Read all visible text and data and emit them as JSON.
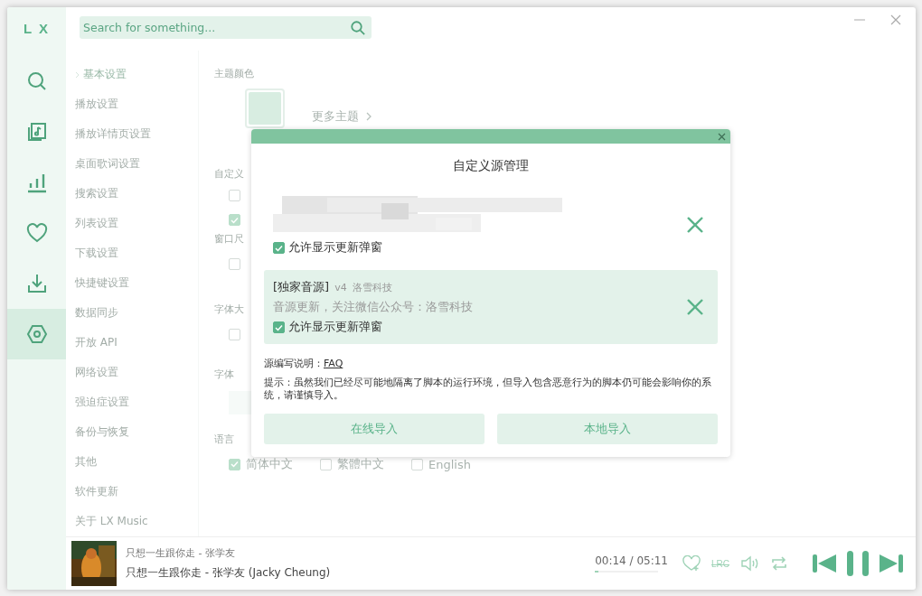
{
  "logo": "L X",
  "nav": [
    {
      "kind": "search",
      "selected": false
    },
    {
      "kind": "songlist",
      "selected": false
    },
    {
      "kind": "chart",
      "selected": false
    },
    {
      "kind": "heart",
      "selected": false
    },
    {
      "kind": "download",
      "selected": false
    },
    {
      "kind": "settings",
      "selected": true
    }
  ],
  "search": {
    "placeholder": "Search for something..."
  },
  "settings_menu": [
    {
      "label": "基本设置",
      "selected": true
    },
    {
      "label": "播放设置",
      "selected": false
    },
    {
      "label": "播放详情页设置",
      "selected": false
    },
    {
      "label": "桌面歌词设置",
      "selected": false
    },
    {
      "label": "搜索设置",
      "selected": false
    },
    {
      "label": "列表设置",
      "selected": false
    },
    {
      "label": "下载设置",
      "selected": false
    },
    {
      "label": "快捷键设置",
      "selected": false
    },
    {
      "label": "数据同步",
      "selected": false
    },
    {
      "label": "开放 API",
      "selected": false
    },
    {
      "label": "网络设置",
      "selected": false
    },
    {
      "label": "强迫症设置",
      "selected": false
    },
    {
      "label": "备份与恢复",
      "selected": false
    },
    {
      "label": "其他",
      "selected": false
    },
    {
      "label": "软件更新",
      "selected": false
    },
    {
      "label": "关于 LX Music",
      "selected": false
    }
  ],
  "settings": {
    "theme_label": "主题颜色",
    "more_themes": "更多主题",
    "sections": [
      {
        "title": "自定义",
        "options": [
          {
            "checked": false
          },
          {
            "checked": true
          }
        ]
      },
      {
        "title": "窗口尺",
        "options": [
          {
            "checked": false
          }
        ]
      },
      {
        "title": "字体大",
        "options": [
          {
            "checked": false
          }
        ]
      },
      {
        "title": "字体",
        "dropdown": true
      }
    ],
    "language": {
      "title": "语言",
      "options": [
        {
          "label": "简体中文",
          "checked": true
        },
        {
          "label": "繁體中文",
          "checked": false
        },
        {
          "label": "English",
          "checked": false
        }
      ]
    }
  },
  "dialog": {
    "title": "自定义源管理",
    "sources": [
      {
        "kind": "redacted",
        "selected": false,
        "allow_update": {
          "label": "允许显示更新弹窗",
          "checked": true
        }
      },
      {
        "kind": "source",
        "selected": true,
        "name": "[独家音源]",
        "version": "v4",
        "author": "洛雪科技",
        "description": "音源更新，关注微信公众号：洛雪科技",
        "allow_update": {
          "label": "允许显示更新弹窗",
          "checked": true
        }
      }
    ],
    "doc_label": "源编写说明：",
    "doc_link": "FAQ",
    "note": "提示：虽然我们已经尽可能地隔离了脚本的运行环境，但导入包含恶意行为的脚本仍可能会影响你的系统，请谨慎导入。",
    "buttons": [
      "在线导入",
      "本地导入"
    ]
  },
  "player": {
    "title": "只想一生跟你走 - 张学友",
    "lyric": "只想一生跟你走 - 张学友 (Jacky Cheung)",
    "time": "00:14 / 05:11",
    "level": 0.05,
    "lrc": "LRC"
  }
}
